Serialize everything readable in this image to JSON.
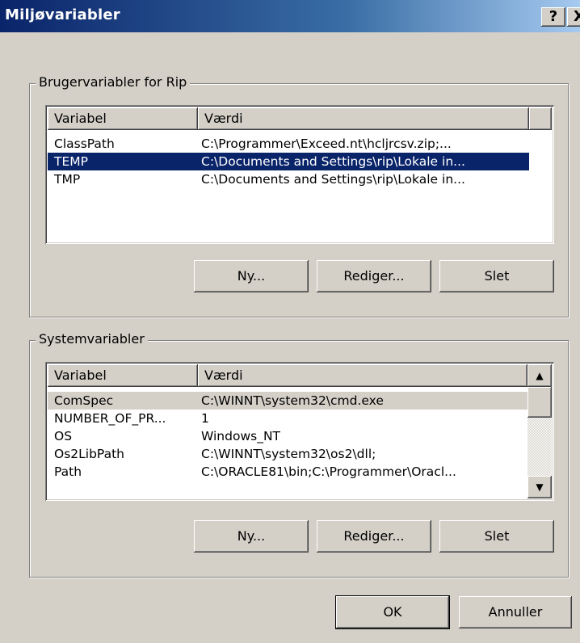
{
  "window": {
    "title": "Miljøvariabler",
    "help_glyph": "?",
    "close_glyph": "X"
  },
  "user_group": {
    "label": "Brugervariabler for Rip",
    "columns": [
      "Variabel",
      "Værdi"
    ],
    "rows": [
      {
        "name": "ClassPath",
        "value": "C:\\Programmer\\Exceed.nt\\hcljrcsv.zip;...",
        "selected": false
      },
      {
        "name": "TEMP",
        "value": "C:\\Documents and Settings\\rip\\Lokale in...",
        "selected": true
      },
      {
        "name": "TMP",
        "value": "C:\\Documents and Settings\\rip\\Lokale in...",
        "selected": false
      }
    ],
    "buttons": {
      "new": "Ny...",
      "edit": "Rediger...",
      "delete": "Slet"
    }
  },
  "system_group": {
    "label": "Systemvariabler",
    "columns": [
      "Variabel",
      "Værdi"
    ],
    "rows": [
      {
        "name": "ComSpec",
        "value": "C:\\WINNT\\system32\\cmd.exe",
        "focused": true
      },
      {
        "name": "NUMBER_OF_PR...",
        "value": "1",
        "focused": false
      },
      {
        "name": "OS",
        "value": "Windows_NT",
        "focused": false
      },
      {
        "name": "Os2LibPath",
        "value": "C:\\WINNT\\system32\\os2\\dll;",
        "focused": false
      },
      {
        "name": "Path",
        "value": "C:\\ORACLE81\\bin;C:\\Programmer\\Oracl...",
        "focused": false
      }
    ],
    "buttons": {
      "new": "Ny...",
      "edit": "Rediger...",
      "delete": "Slet"
    }
  },
  "footer": {
    "ok": "OK",
    "cancel": "Annuller"
  },
  "icons": {
    "scroll_up": "scroll-up-arrow-icon",
    "scroll_down": "scroll-down-arrow-icon"
  },
  "colors": {
    "selection": "#0a246a",
    "face": "#d4d0c8",
    "title_start": "#0a246a",
    "title_end": "#a6caf0"
  }
}
